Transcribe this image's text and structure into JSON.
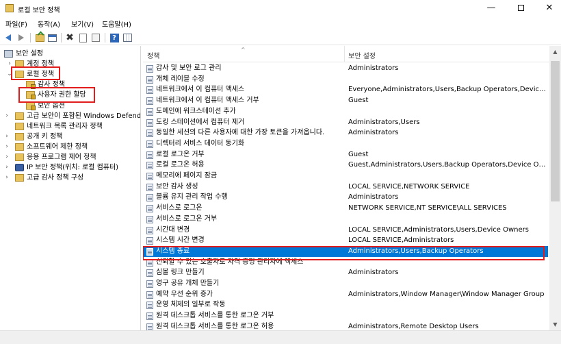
{
  "window": {
    "title": "로컬 보안 정책",
    "minimize_glyph": "—",
    "close_glyph": "✕"
  },
  "menu": {
    "file": "파일(F)",
    "action": "동작(A)",
    "view": "보기(V)",
    "help": "도움말(H)"
  },
  "toolbar": {
    "icons": [
      "back-arrow-icon",
      "forward-arrow-icon",
      "up-folder-icon",
      "show-hide-console-tree-icon",
      "delete-icon",
      "properties-icon",
      "export-list-icon",
      "help-icon",
      "view-icon"
    ],
    "help_glyph": "?"
  },
  "tree": {
    "root": "보안 설정",
    "account_policy": "계정 정책",
    "local_policy": "로컬 정책",
    "audit_policy": "감사 정책",
    "user_rights": "사용자 권한 할당",
    "security_options": "보안 옵션",
    "firewall": "고급 보안이 포함된 Windows Defender",
    "network_list": "네트워크 목록 관리자 정책",
    "public_key": "공개 키 정책",
    "software_restriction": "소프트웨어 제한 정책",
    "app_control": "응용 프로그램 제어 정책",
    "ipsec": "IP 보안 정책(위치: 로컬 컴퓨터)",
    "advanced_audit": "고급 감사 정책 구성"
  },
  "list": {
    "col_policy": "정책",
    "col_setting": "보안 설정",
    "sort_glyph": "^",
    "rows": [
      {
        "name": "감사 및 보안 로그 관리",
        "value": "Administrators"
      },
      {
        "name": "개체 레이블 수정",
        "value": ""
      },
      {
        "name": "네트워크에서 이 컴퓨터 액세스",
        "value": "Everyone,Administrators,Users,Backup Operators,Device Ow..."
      },
      {
        "name": "네트워크에서 이 컴퓨터 액세스 거부",
        "value": "Guest"
      },
      {
        "name": "도메인에 워크스테이션 추가",
        "value": ""
      },
      {
        "name": "도킹 스테이션에서 컴퓨터 제거",
        "value": "Administrators,Users"
      },
      {
        "name": "동일한 세션의 다른 사용자에 대한 가장 토큰을 가져옵니다.",
        "value": "Administrators"
      },
      {
        "name": "디렉터리 서비스 데이터 동기화",
        "value": ""
      },
      {
        "name": "로컬 로그온 거부",
        "value": "Guest"
      },
      {
        "name": "로컬 로그온 허용",
        "value": "Guest,Administrators,Users,Backup Operators,Device Owners..."
      },
      {
        "name": "메모리에 페이지 잠금",
        "value": ""
      },
      {
        "name": "보안 감사 생성",
        "value": "LOCAL SERVICE,NETWORK SERVICE"
      },
      {
        "name": "볼륨 유지 관리 작업 수행",
        "value": "Administrators"
      },
      {
        "name": "서비스로 로그온",
        "value": "NETWORK SERVICE,NT SERVICE\\ALL SERVICES"
      },
      {
        "name": "서비스로 로그온 거부",
        "value": ""
      },
      {
        "name": "시간대 변경",
        "value": "LOCAL SERVICE,Administrators,Users,Device Owners"
      },
      {
        "name": "시스템 시간 변경",
        "value": "LOCAL SERVICE,Administrators"
      },
      {
        "name": "시스템 종료",
        "value": "Administrators,Users,Backup Operators"
      },
      {
        "name": "신뢰할 수 있는 호출자로 자격 증명 관리자에 액세스",
        "value": ""
      },
      {
        "name": "심볼 링크 만들기",
        "value": "Administrators"
      },
      {
        "name": "영구 공유 개체 만들기",
        "value": ""
      },
      {
        "name": "예약 우선 순위 증가",
        "value": "Administrators,Window Manager\\Window Manager Group"
      },
      {
        "name": "운영 체제의 일부로 작동",
        "value": ""
      },
      {
        "name": "원격 데스크톱 서비스를 통한 로그온 거부",
        "value": ""
      },
      {
        "name": "원격 데스크톱 서비스를 통한 로그온 허용",
        "value": "Administrators,Remote Desktop Users"
      }
    ]
  },
  "scrollbar": {
    "up_glyph": "▲",
    "down_glyph": "▼"
  },
  "colors": {
    "selection": "#0078d7",
    "highlight_box": "#e21b1b"
  }
}
